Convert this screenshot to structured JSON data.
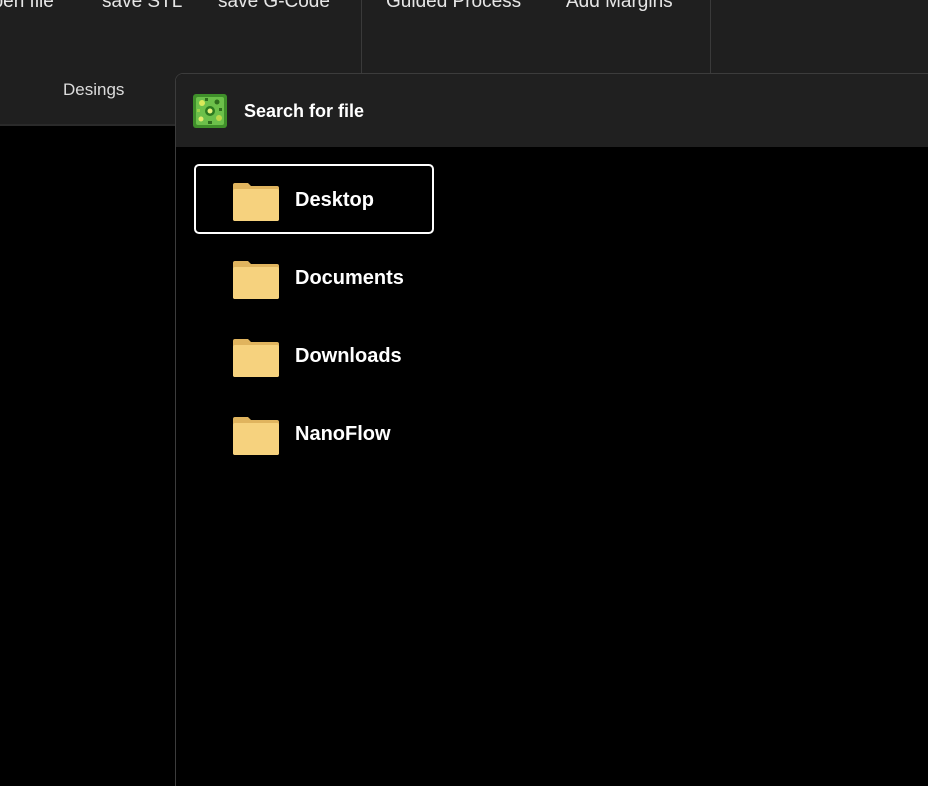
{
  "ribbon": {
    "buttons": [
      "open file",
      "save STL",
      "save G-Code",
      "Guided Process",
      "Add Margins"
    ],
    "group_label": "Desings"
  },
  "dialog": {
    "title": "Search for file",
    "selected_index": 0,
    "folders": [
      {
        "name": "Desktop"
      },
      {
        "name": "Documents"
      },
      {
        "name": "Downloads"
      },
      {
        "name": "NanoFlow"
      }
    ]
  },
  "colors": {
    "ribbon_bg": "#1f1f1f",
    "dialog_titlebar_bg": "#202020",
    "content_bg": "#000000",
    "folder_yellow": "#f6d27e",
    "selection_border": "#ffffff",
    "logo_green": "#4caf2f"
  },
  "icons": {
    "folder": "folder-icon",
    "logo": "app-logo-icon"
  }
}
